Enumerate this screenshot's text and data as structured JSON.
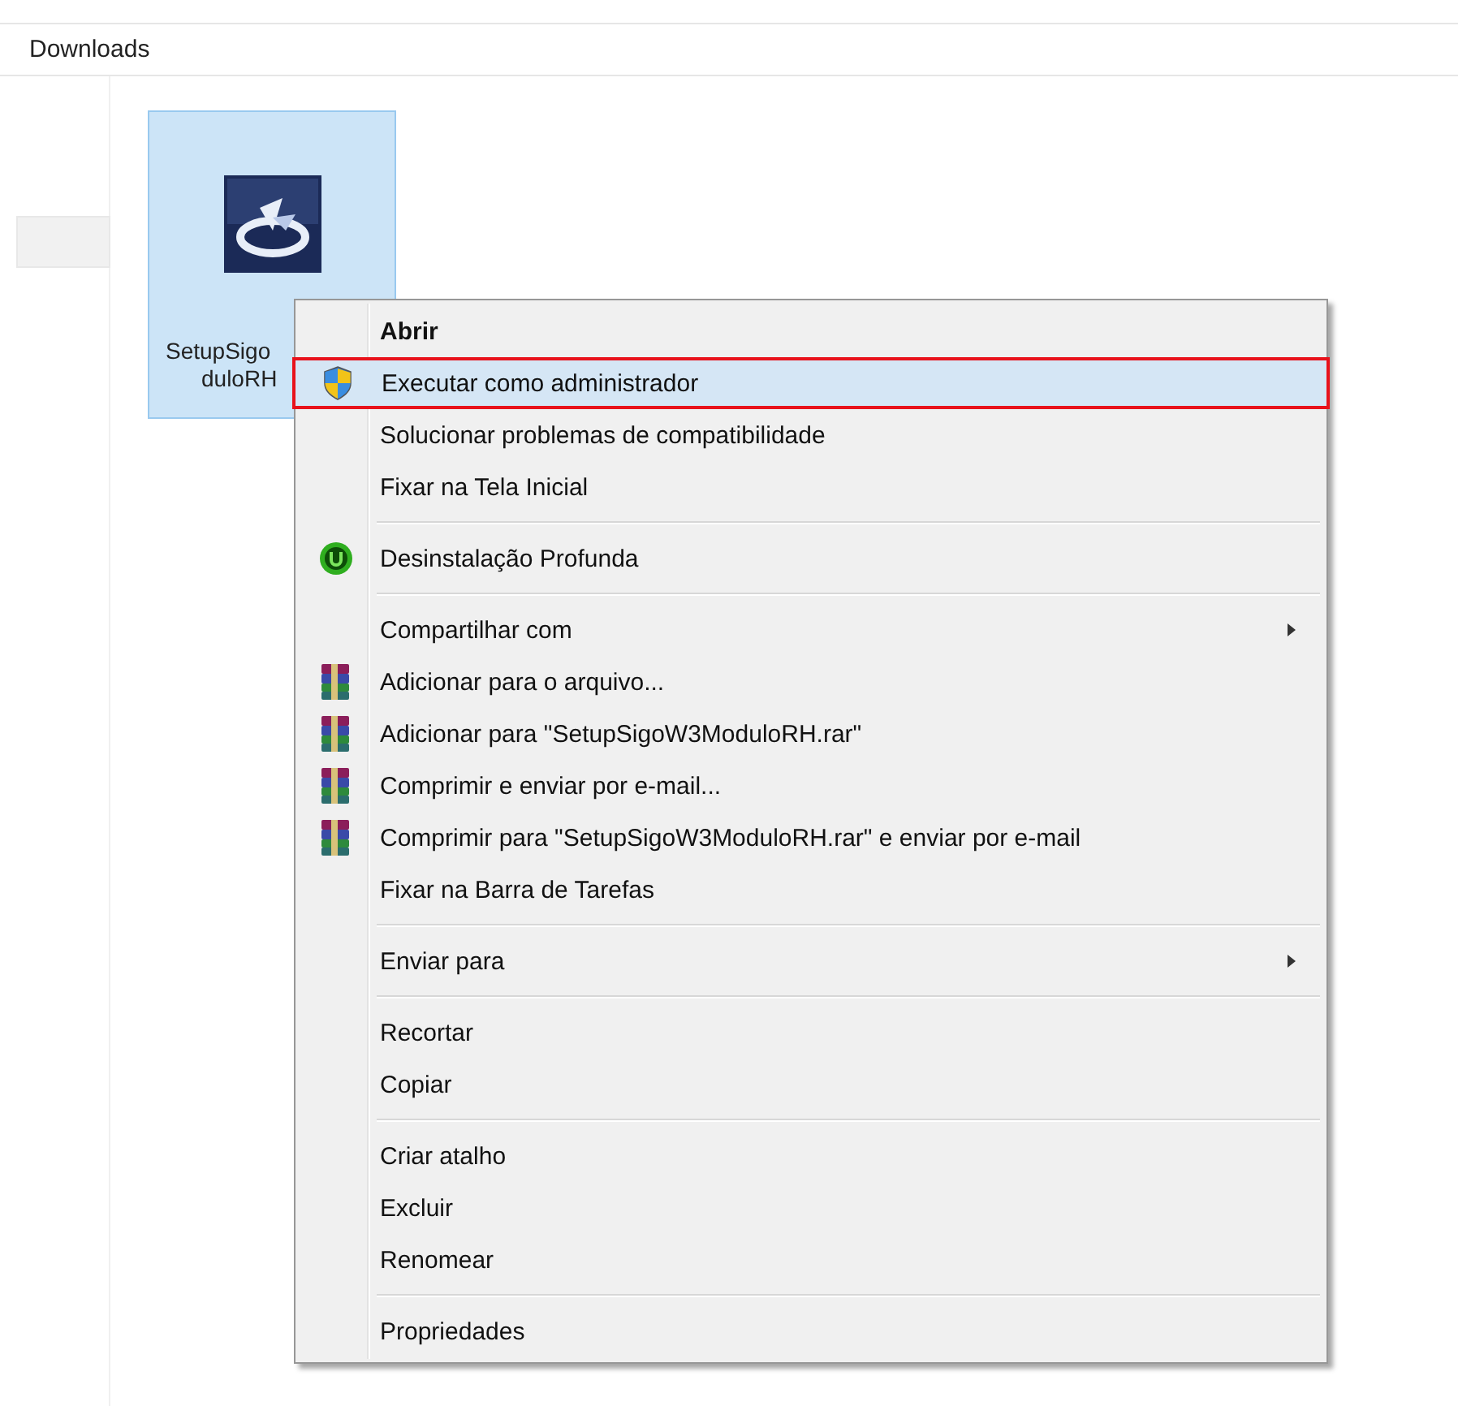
{
  "address_bar": {
    "location": "Downloads"
  },
  "file": {
    "name_lines": [
      "SetupSigo",
      "duloRH"
    ],
    "selected": true
  },
  "context_menu": {
    "items": [
      {
        "kind": "item",
        "label": "Abrir",
        "bold": true,
        "selected": false,
        "submenu": false
      },
      {
        "kind": "shield",
        "label": "Executar como administrador",
        "bold": false,
        "selected": true,
        "submenu": false
      },
      {
        "kind": "item",
        "label": "Solucionar problemas de compatibilidade",
        "bold": false,
        "selected": false,
        "submenu": false
      },
      {
        "kind": "item",
        "label": "Fixar na Tela Inicial",
        "bold": false,
        "selected": false,
        "submenu": false
      },
      {
        "kind": "separator"
      },
      {
        "kind": "uninstall",
        "label": "Desinstalação Profunda",
        "bold": false,
        "selected": false,
        "submenu": false
      },
      {
        "kind": "separator"
      },
      {
        "kind": "item",
        "label": "Compartilhar com",
        "bold": false,
        "selected": false,
        "submenu": true
      },
      {
        "kind": "archive",
        "label": "Adicionar para o arquivo...",
        "bold": false,
        "selected": false,
        "submenu": false
      },
      {
        "kind": "archive",
        "label": "Adicionar para \"SetupSigoW3ModuloRH.rar\"",
        "bold": false,
        "selected": false,
        "submenu": false
      },
      {
        "kind": "archive",
        "label": "Comprimir e enviar por e-mail...",
        "bold": false,
        "selected": false,
        "submenu": false
      },
      {
        "kind": "archive",
        "label": "Comprimir para \"SetupSigoW3ModuloRH.rar\" e enviar por e-mail",
        "bold": false,
        "selected": false,
        "submenu": false
      },
      {
        "kind": "item",
        "label": "Fixar na Barra de Tarefas",
        "bold": false,
        "selected": false,
        "submenu": false
      },
      {
        "kind": "separator"
      },
      {
        "kind": "item",
        "label": "Enviar para",
        "bold": false,
        "selected": false,
        "submenu": true
      },
      {
        "kind": "separator"
      },
      {
        "kind": "item",
        "label": "Recortar",
        "bold": false,
        "selected": false,
        "submenu": false
      },
      {
        "kind": "item",
        "label": "Copiar",
        "bold": false,
        "selected": false,
        "submenu": false
      },
      {
        "kind": "separator"
      },
      {
        "kind": "item",
        "label": "Criar atalho",
        "bold": false,
        "selected": false,
        "submenu": false
      },
      {
        "kind": "item",
        "label": "Excluir",
        "bold": false,
        "selected": false,
        "submenu": false
      },
      {
        "kind": "item",
        "label": "Renomear",
        "bold": false,
        "selected": false,
        "submenu": false
      },
      {
        "kind": "separator"
      },
      {
        "kind": "item",
        "label": "Propriedades",
        "bold": false,
        "selected": false,
        "submenu": false
      }
    ]
  }
}
